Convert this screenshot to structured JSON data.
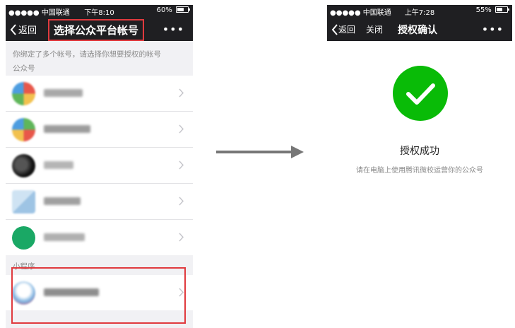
{
  "left": {
    "status": {
      "carrier": "●●●●● 中国联通",
      "time": "下午8:10",
      "battery": "60%",
      "battery_level": 0.6
    },
    "nav": {
      "back": "返回",
      "title": "选择公众平台帐号",
      "more": "•••"
    },
    "hint": "你绑定了多个帐号，请选择你想要授权的帐号",
    "official_section": "公众号",
    "mini_section": "小程序",
    "accounts": [
      "account-1",
      "account-2",
      "account-3",
      "account-4",
      "account-5"
    ],
    "mini_program": "mini-program-1"
  },
  "right": {
    "status": {
      "carrier": "●●●●● 中国联通",
      "time": "上午7:28",
      "battery": "55%",
      "battery_level": 0.55
    },
    "nav": {
      "back": "返回",
      "close": "关闭",
      "title": "授权确认",
      "more": "•••"
    },
    "success_title": "授权成功",
    "success_desc": "请在电脑上使用腾讯微校运营你的公众号"
  },
  "colors": {
    "nav_bg": "#1f1f22",
    "highlight": "#e03a3e",
    "success": "#09bb07",
    "page_bg": "#f1f1f4"
  }
}
